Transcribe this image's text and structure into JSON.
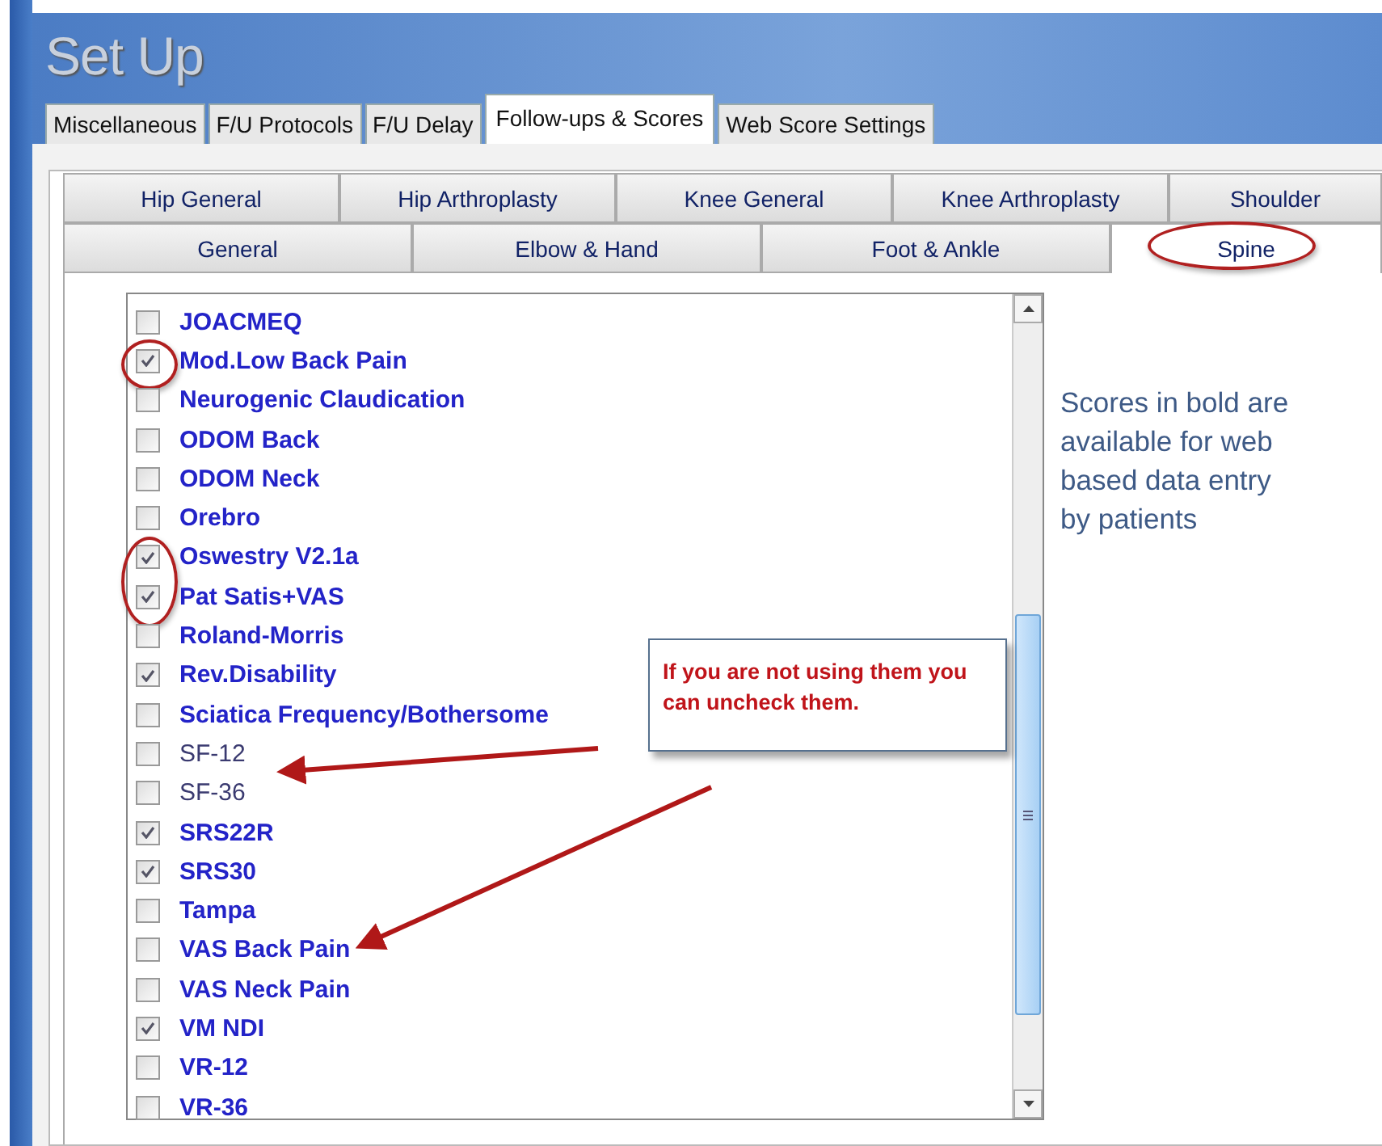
{
  "window": {
    "title": "Set Up"
  },
  "main_tabs": [
    {
      "label": "Miscellaneous",
      "selected": false
    },
    {
      "label": "F/U Protocols",
      "selected": false
    },
    {
      "label": "F/U Delay",
      "selected": false
    },
    {
      "label": "Follow-ups & Scores",
      "selected": true
    },
    {
      "label": "Web Score Settings",
      "selected": false
    }
  ],
  "sub_tab_rows": [
    [
      {
        "label": "Hip General",
        "selected": false,
        "circled": false
      },
      {
        "label": "Hip Arthroplasty",
        "selected": false,
        "circled": false
      },
      {
        "label": "Knee General",
        "selected": false,
        "circled": false
      },
      {
        "label": "Knee Arthroplasty",
        "selected": false,
        "circled": false
      },
      {
        "label": "Shoulder",
        "selected": false,
        "circled": false
      }
    ],
    [
      {
        "label": "General",
        "selected": false,
        "circled": false
      },
      {
        "label": "Elbow & Hand",
        "selected": false,
        "circled": false
      },
      {
        "label": "Foot & Ankle",
        "selected": false,
        "circled": false
      },
      {
        "label": "Spine",
        "selected": true,
        "circled": true
      }
    ]
  ],
  "scores": [
    {
      "label": "JOACMEQ",
      "checked": false,
      "bold": true,
      "circled": false
    },
    {
      "label": "Mod.Low Back Pain",
      "checked": true,
      "bold": true,
      "circled": true
    },
    {
      "label": "Neurogenic Claudication",
      "checked": false,
      "bold": true,
      "circled": false
    },
    {
      "label": "ODOM Back",
      "checked": false,
      "bold": true,
      "circled": false
    },
    {
      "label": "ODOM Neck",
      "checked": false,
      "bold": true,
      "circled": false
    },
    {
      "label": "Orebro",
      "checked": false,
      "bold": true,
      "circled": false
    },
    {
      "label": "Oswestry V2.1a",
      "checked": true,
      "bold": true,
      "circled": true
    },
    {
      "label": "Pat Satis+VAS",
      "checked": true,
      "bold": true,
      "circled": true
    },
    {
      "label": "Roland-Morris",
      "checked": false,
      "bold": true,
      "circled": false
    },
    {
      "label": "Rev.Disability",
      "checked": true,
      "bold": true,
      "circled": false
    },
    {
      "label": "Sciatica Frequency/Bothersome",
      "checked": false,
      "bold": true,
      "circled": false
    },
    {
      "label": "SF-12",
      "checked": false,
      "bold": false,
      "circled": false
    },
    {
      "label": "SF-36",
      "checked": false,
      "bold": false,
      "circled": false
    },
    {
      "label": "SRS22R",
      "checked": true,
      "bold": true,
      "circled": false
    },
    {
      "label": "SRS30",
      "checked": true,
      "bold": true,
      "circled": false
    },
    {
      "label": "Tampa",
      "checked": false,
      "bold": true,
      "circled": false
    },
    {
      "label": "VAS Back Pain",
      "checked": false,
      "bold": true,
      "circled": false
    },
    {
      "label": "VAS Neck Pain",
      "checked": false,
      "bold": true,
      "circled": false
    },
    {
      "label": "VM NDI",
      "checked": true,
      "bold": true,
      "circled": false
    },
    {
      "label": "VR-12",
      "checked": false,
      "bold": true,
      "circled": false
    },
    {
      "label": "VR-36",
      "checked": false,
      "bold": true,
      "circled": false
    }
  ],
  "note": "Scores in bold are available for web based data entry by patients",
  "callout": "If you are not using them you can uncheck them."
}
